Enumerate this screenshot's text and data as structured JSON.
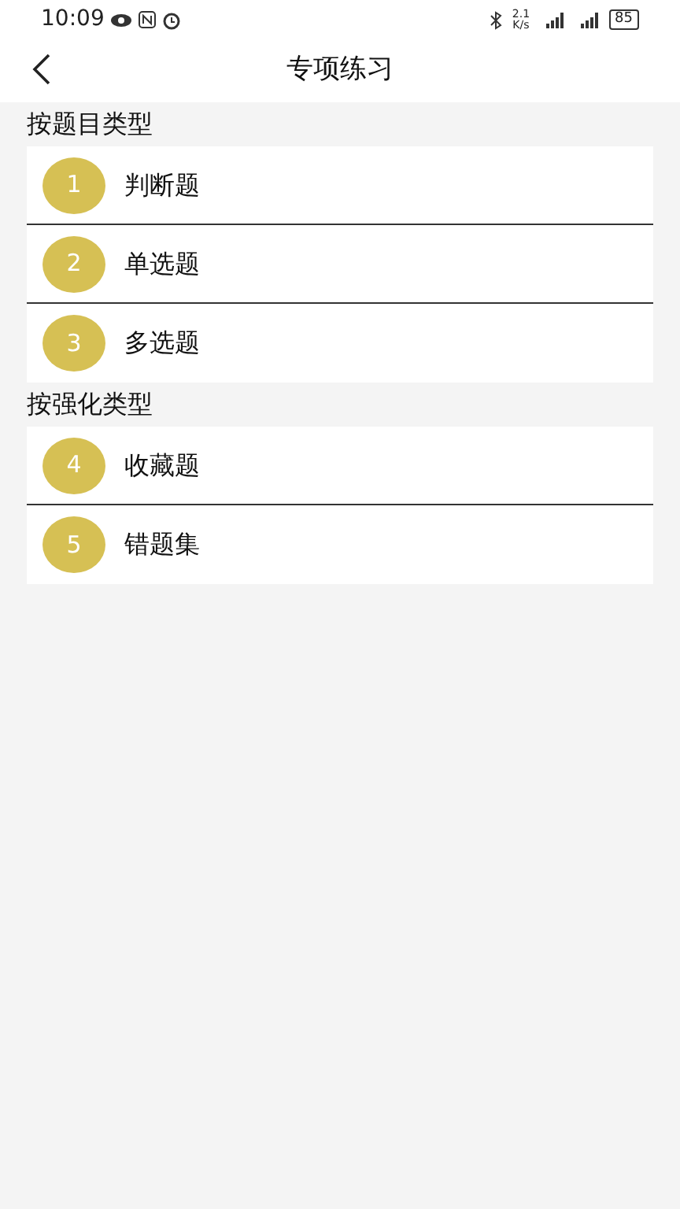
{
  "status_bar": {
    "time": "10:09",
    "speed": "2.1",
    "speed_unit": "K/s",
    "battery": "85"
  },
  "header": {
    "title": "专项练习"
  },
  "sections": [
    {
      "title": "按题目类型",
      "items": [
        {
          "number": "1",
          "label": "判断题"
        },
        {
          "number": "2",
          "label": "单选题"
        },
        {
          "number": "3",
          "label": "多选题"
        }
      ]
    },
    {
      "title": "按强化类型",
      "items": [
        {
          "number": "4",
          "label": "收藏题"
        },
        {
          "number": "5",
          "label": "错题集"
        }
      ]
    }
  ]
}
